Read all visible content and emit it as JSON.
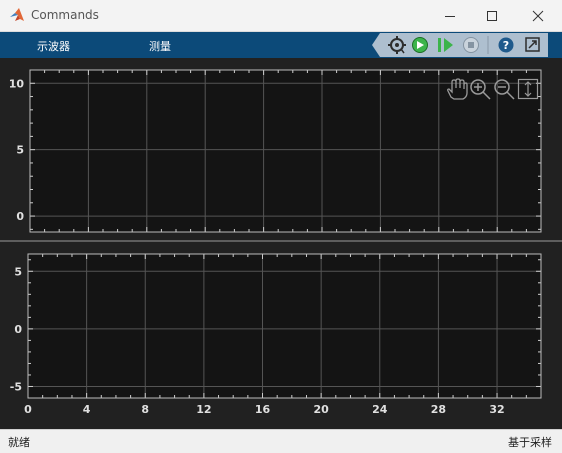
{
  "window": {
    "title": "Commands",
    "controls": [
      "minimize-icon",
      "maximize-icon",
      "close-icon"
    ]
  },
  "tabs": [
    {
      "label": "示波器"
    },
    {
      "label": "测量"
    }
  ],
  "toolstrip": {
    "icons": [
      "settings-gear-icon",
      "run-icon",
      "step-forward-icon",
      "stop-icon",
      "help-icon",
      "undock-icon"
    ]
  },
  "plot_toolbar": {
    "icons": [
      "pan-hand-icon",
      "zoom-in-icon",
      "zoom-out-icon",
      "fit-axes-icon"
    ]
  },
  "status": {
    "left": "就绪",
    "right": "基于采样"
  },
  "colors": {
    "tabbar": "#0c4a79",
    "plot_background": "#141414",
    "figure_background": "#212121",
    "grid": "#555555"
  },
  "chart_data": [
    {
      "type": "line",
      "title": "",
      "xlabel": "",
      "ylabel": "",
      "series": [],
      "ylim": [
        -1.2,
        11
      ],
      "yticks": [
        0,
        5,
        10
      ],
      "xlim": [
        0,
        35
      ],
      "grid": true
    },
    {
      "type": "line",
      "title": "",
      "xlabel": "",
      "ylabel": "",
      "series": [],
      "ylim": [
        -6,
        6.5
      ],
      "yticks": [
        -5,
        0,
        5
      ],
      "xlim": [
        0,
        35
      ],
      "xticks": [
        0,
        4,
        8,
        12,
        16,
        20,
        24,
        28,
        32
      ],
      "grid": true
    }
  ]
}
